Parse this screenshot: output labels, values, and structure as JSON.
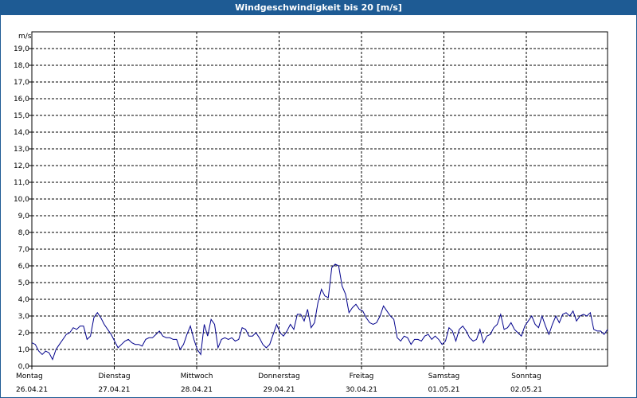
{
  "window": {
    "title": "Windgeschwindigkeit bis 20 [m/s]"
  },
  "chart_data": {
    "type": "line",
    "title": "Windgeschwindigkeit bis 20 [m/s]",
    "ylabel": "m/s",
    "ylim": [
      0,
      20
    ],
    "y_ticks": [
      "0,0",
      "1,0",
      "2,0",
      "3,0",
      "4,0",
      "5,0",
      "6,0",
      "7,0",
      "8,0",
      "9,0",
      "10,0",
      "11,0",
      "12,0",
      "13,0",
      "14,0",
      "15,0",
      "16,0",
      "17,0",
      "18,0",
      "19,0"
    ],
    "x_ticks": [
      {
        "day": "Montag",
        "date": "26.04.21"
      },
      {
        "day": "Dienstag",
        "date": "27.04.21"
      },
      {
        "day": "Mittwoch",
        "date": "28.04.21"
      },
      {
        "day": "Donnerstag",
        "date": "29.04.21"
      },
      {
        "day": "Freitag",
        "date": "30.04.21"
      },
      {
        "day": "Samstag",
        "date": "01.05.21"
      },
      {
        "day": "Sonntag",
        "date": "02.05.21"
      }
    ],
    "grid": true,
    "line_color": "#00008b",
    "series": [
      {
        "name": "",
        "values": [
          1.4,
          1.3,
          0.9,
          0.7,
          0.9,
          0.8,
          0.4,
          1.0,
          1.3,
          1.6,
          1.9,
          2.0,
          2.3,
          2.2,
          2.4,
          2.4,
          1.6,
          1.8,
          2.9,
          3.2,
          2.9,
          2.5,
          2.2,
          1.9,
          1.5,
          1.1,
          1.3,
          1.5,
          1.6,
          1.4,
          1.3,
          1.3,
          1.2,
          1.6,
          1.7,
          1.7,
          1.9,
          2.1,
          1.8,
          1.7,
          1.7,
          1.6,
          1.6,
          1.0,
          1.3,
          1.9,
          2.4,
          1.6,
          1.0,
          0.7,
          2.5,
          1.8,
          2.8,
          2.5,
          1.1,
          1.6,
          1.7,
          1.6,
          1.7,
          1.5,
          1.6,
          2.3,
          2.2,
          1.8,
          1.8,
          2.0,
          1.7,
          1.3,
          1.1,
          1.3,
          1.9,
          2.5,
          2.0,
          1.8,
          2.1,
          2.5,
          2.2,
          3.1,
          3.1,
          2.7,
          3.4,
          2.3,
          2.6,
          3.8,
          4.6,
          4.2,
          4.1,
          5.9,
          6.1,
          6.0,
          4.8,
          4.3,
          3.2,
          3.5,
          3.7,
          3.4,
          3.3,
          2.9,
          2.6,
          2.5,
          2.6,
          3.0,
          3.6,
          3.3,
          3.0,
          2.8,
          1.7,
          1.5,
          1.8,
          1.7,
          1.3,
          1.6,
          1.6,
          1.5,
          1.8,
          1.9,
          1.6,
          1.8,
          1.6,
          1.3,
          1.5,
          2.3,
          2.1,
          1.5,
          2.2,
          2.4,
          2.1,
          1.7,
          1.5,
          1.6,
          2.2,
          1.4,
          1.8,
          1.9,
          2.3,
          2.5,
          3.1,
          2.2,
          2.3,
          2.6,
          2.2,
          2.0,
          1.8,
          2.4,
          2.7,
          3.0,
          2.5,
          2.3,
          3.0,
          2.4,
          1.9,
          2.5,
          3.0,
          2.6,
          3.1,
          3.2,
          3.0,
          3.3,
          2.7,
          3.0,
          3.1,
          3.0,
          3.2,
          2.2,
          2.1,
          2.1,
          1.9,
          2.2
        ]
      }
    ]
  }
}
